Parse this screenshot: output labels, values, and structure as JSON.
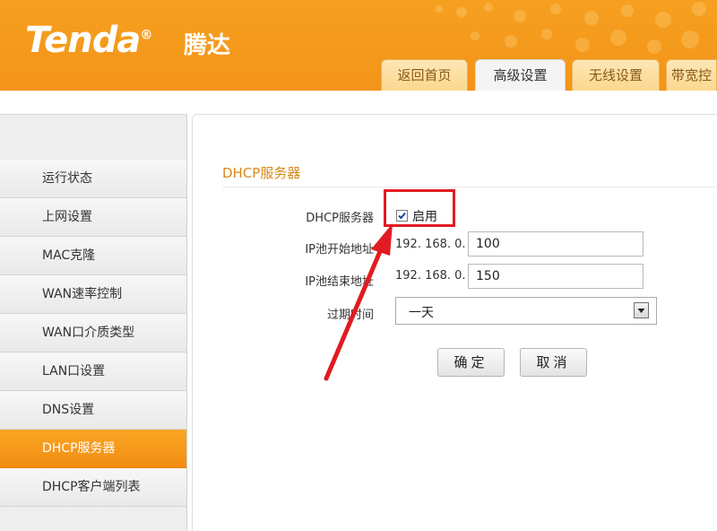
{
  "header": {
    "logo": "Tenda",
    "logo_reg": "®",
    "logo_cn": "腾达",
    "tabs": [
      {
        "label": "返回首页"
      },
      {
        "label": "高级设置",
        "active": true
      },
      {
        "label": "无线设置"
      },
      {
        "label": "带宽控"
      }
    ]
  },
  "sidebar": {
    "items": [
      {
        "label": "运行状态"
      },
      {
        "label": "上网设置"
      },
      {
        "label": "MAC克隆"
      },
      {
        "label": "WAN速率控制"
      },
      {
        "label": "WAN口介质类型"
      },
      {
        "label": "LAN口设置"
      },
      {
        "label": "DNS设置"
      },
      {
        "label": "DHCP服务器",
        "active": true
      },
      {
        "label": "DHCP客户端列表"
      }
    ]
  },
  "main": {
    "section_title": "DHCP服务器",
    "dhcp_label": "DHCP服务器",
    "enable_label": "启用",
    "enabled": true,
    "ip_start_label": "IP池开始地址",
    "ip_start_prefix": "192. 168. 0.",
    "ip_start_value": "100",
    "ip_end_label": "IP池结束地址",
    "ip_end_prefix": "192. 168. 0.",
    "ip_end_value": "150",
    "lease_label": "过期时间",
    "lease_value": "一天",
    "confirm_label": "确定",
    "cancel_label": "取消"
  },
  "colors": {
    "brand_orange": "#f39418",
    "annotation_red": "#e11b22",
    "section_title": "#d68a1c"
  }
}
